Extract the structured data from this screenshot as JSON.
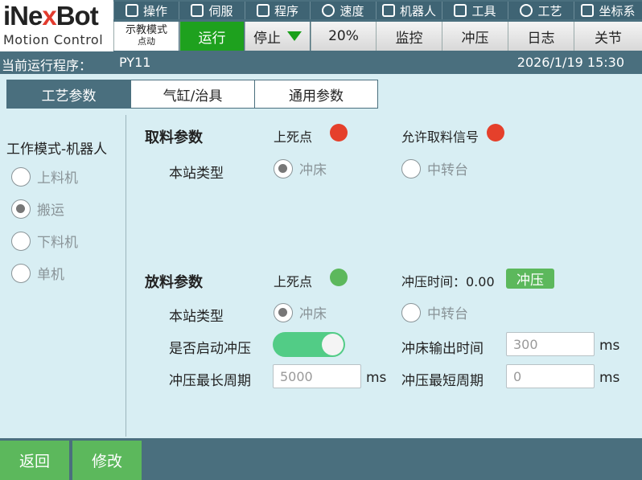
{
  "logo": {
    "brand_i": "i",
    "brand_ne": "Ne",
    "brand_x": "x",
    "brand_bot": "Bot",
    "tagline": "Motion Control"
  },
  "menu": {
    "operate": "操作",
    "servo": "伺服",
    "program": "程序",
    "speed": "速度",
    "robot": "机器人",
    "tool": "工具",
    "process": "工艺",
    "coord": "坐标系"
  },
  "toolbar": {
    "mode": "示教模式",
    "mode_sub": "点动",
    "run": "运行",
    "stop": "停止",
    "speed_value": "20%",
    "monitor": "监控",
    "punch": "冲压",
    "log": "日志",
    "joint": "关节"
  },
  "status": {
    "label": "当前运行程序：",
    "program": "PY11",
    "datetime": "2026/1/19 15:30"
  },
  "tabs": [
    {
      "label": "工艺参数",
      "active": true
    },
    {
      "label": "气缸/治具",
      "active": false
    },
    {
      "label": "通用参数",
      "active": false
    }
  ],
  "left": {
    "title": "工作模式-机器人",
    "options": [
      {
        "label": "上料机",
        "selected": false
      },
      {
        "label": "搬运",
        "selected": true
      },
      {
        "label": "下料机",
        "selected": false
      },
      {
        "label": "单机",
        "selected": false
      }
    ]
  },
  "pick": {
    "title": "取料参数",
    "tdc_label": "上死点",
    "tdc_color": "#e5402b",
    "allow_label": "允许取料信号",
    "allow_color": "#e5402b",
    "station_label": "本站类型",
    "opt_press": "冲床",
    "opt_transfer": "中转台",
    "selected": "冲床"
  },
  "place": {
    "title": "放料参数",
    "tdc_label": "上死点",
    "tdc_color": "#5cb85c",
    "press_time_label": "冲压时间：0.00",
    "press_button": "冲压",
    "station_label": "本站类型",
    "opt_press": "冲床",
    "opt_transfer": "中转台",
    "selected": "冲床",
    "enable_label": "是否启动冲压",
    "enable_on": true,
    "output_time_label": "冲床输出时间",
    "output_time_value": "300",
    "max_cycle_label": "冲压最长周期",
    "max_cycle_value": "5000",
    "min_cycle_label": "冲压最短周期",
    "min_cycle_value": "0",
    "unit": "ms"
  },
  "bottom": {
    "back": "返回",
    "modify": "修改"
  }
}
